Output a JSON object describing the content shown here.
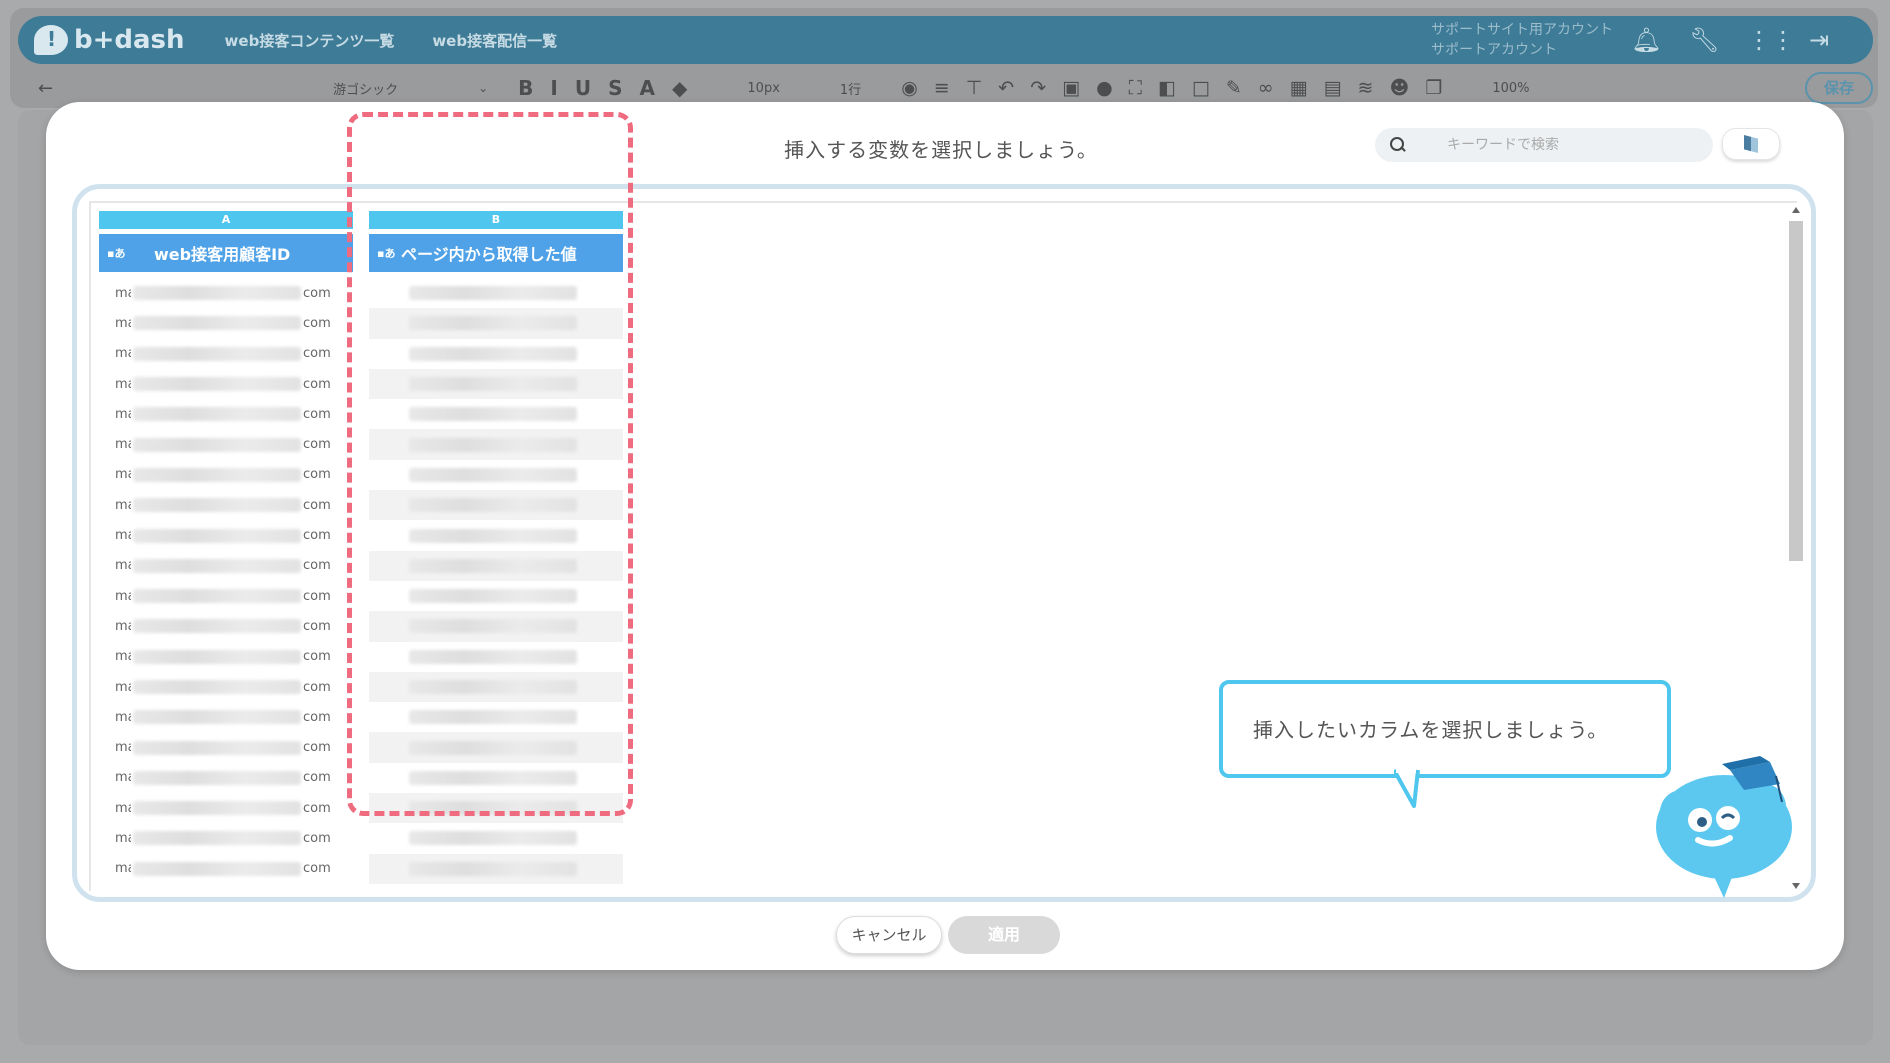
{
  "app": {
    "logo": "b+dash",
    "nav": [
      "web接客コンテンツ一覧",
      "web接客配信一覧"
    ],
    "account": [
      "サポートサイト用アカウント",
      "サポートアカウント"
    ],
    "icons": [
      "bell-icon",
      "wrench-icon",
      "grid-icon",
      "logout-icon"
    ]
  },
  "toolbar": {
    "back": "←",
    "font": "游ゴシック",
    "size": "10px",
    "line": "1行",
    "zoom": "100%",
    "save_label": "保存",
    "format_icons": [
      "B",
      "I",
      "U",
      "S",
      "A",
      "◆"
    ]
  },
  "modal": {
    "title": "挿入する変数を選択しましょう。",
    "search_placeholder": "キーワードで検索",
    "columns": [
      {
        "letter": "A",
        "icon": "▪あ",
        "header": "web接客用顧客ID",
        "prefix": "ma",
        "suffix": "com"
      },
      {
        "letter": "B",
        "icon": "▪あ",
        "header": "ページ内から取得した値",
        "prefix": "",
        "suffix": ""
      }
    ],
    "tip": "挿入したいカラムを選択しましょう。",
    "cancel_label": "キャンセル",
    "apply_label": "適用"
  },
  "colors": {
    "accent": "#4ec6ee",
    "header": "#4fa2e7",
    "highlight": "#ef6c80",
    "topbar": "#3d7b97"
  }
}
